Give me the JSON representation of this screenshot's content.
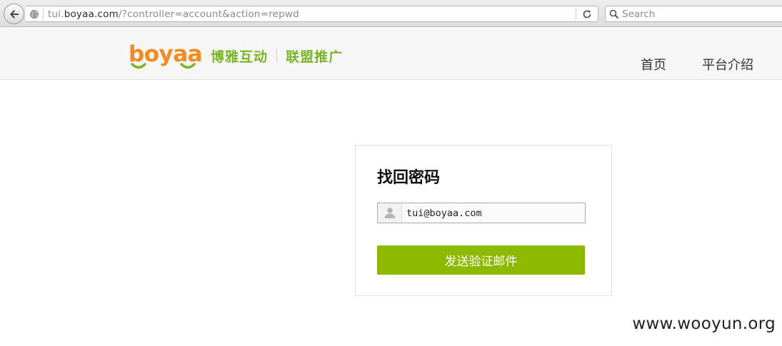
{
  "browser": {
    "url_prefix": "tui.",
    "url_host": "boyaa.com",
    "url_path": "/?controller=account&action=repwd",
    "search_placeholder": "Search"
  },
  "header": {
    "logo_text": "boyaa",
    "logo_cn": "博雅互动",
    "logo_sub": "联盟推广",
    "nav": [
      "首页",
      "平台介绍"
    ]
  },
  "card": {
    "title": "找回密码",
    "email_value": "tui@boyaa.com",
    "button_label": "发送验证邮件"
  },
  "watermark": "www.wooyun.org",
  "colors": {
    "brand_orange": "#f58a1f",
    "brand_green": "#7ab526",
    "button_green": "#8cb800"
  }
}
